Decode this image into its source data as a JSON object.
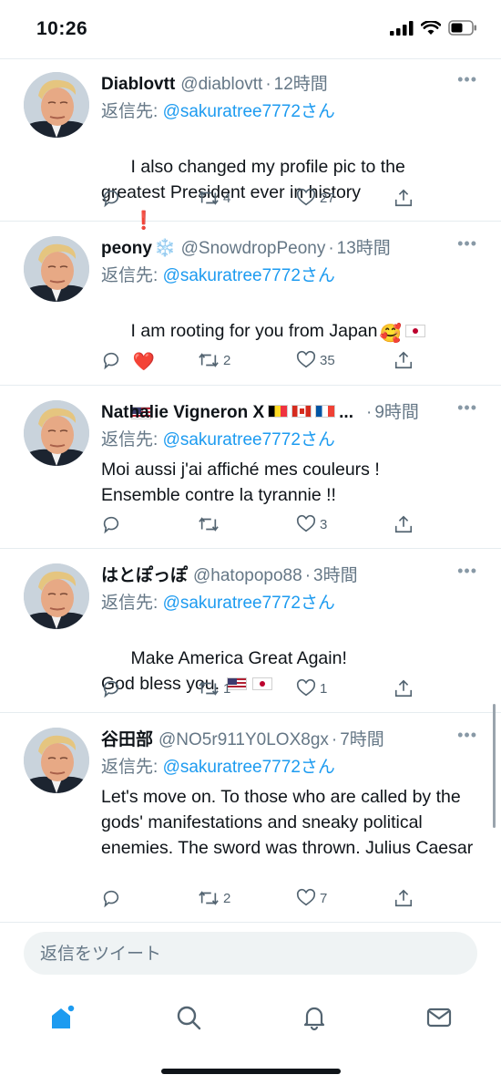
{
  "status_bar": {
    "time": "10:26"
  },
  "tweets": [
    {
      "name": "Diablovtt",
      "handle": "@diablovtt",
      "sep": "·",
      "time": "12時間",
      "reply_prefix": "返信先: ",
      "reply_mention": "@sakuratree7772",
      "reply_suffix": "さん",
      "text": "I also changed my profile pic to the greatest President ever in history",
      "text_emoji": "❗",
      "retweets": "4",
      "likes": "27"
    },
    {
      "name": "peony",
      "name_emoji": "❄️",
      "handle": "@SnowdropPeony",
      "sep": "·",
      "time": "13時間",
      "reply_prefix": "返信先: ",
      "reply_mention": "@sakuratree7772",
      "reply_suffix": "さん",
      "text": "I am rooting for you from Japan",
      "text_emoji": "🥰",
      "heart_emoji": "❤️",
      "retweets": "2",
      "likes": "35"
    },
    {
      "name": "Nathalie Vigneron X",
      "name_suffix": "...",
      "handle": "",
      "sep": "·",
      "time": "9時間",
      "reply_prefix": "返信先: ",
      "reply_mention": "@sakuratree7772",
      "reply_suffix": "さん",
      "text": "Moi aussi j'ai affiché mes couleurs !\nEnsemble contre la tyrannie !!",
      "retweets": "",
      "likes": "3"
    },
    {
      "name": "はとぽっぽ",
      "handle": "@hatopopo88",
      "sep": "·",
      "time": "3時間",
      "reply_prefix": "返信先: ",
      "reply_mention": "@sakuratree7772",
      "reply_suffix": "さん",
      "text": "Make America Great Again!\nGod bless you.",
      "retweets": "1",
      "likes": "1"
    },
    {
      "name": "谷田部",
      "handle": "@NO5r911Y0LOX8gx",
      "sep": "·",
      "time": "7時間",
      "reply_prefix": "返信先: ",
      "reply_mention": "@sakuratree7772",
      "reply_suffix": "さん",
      "text": "Let's move on. To those who are called by the gods' manifestations and sneaky political enemies. The sword was thrown. Julius Caesar",
      "retweets": "2",
      "likes": "7"
    }
  ],
  "composer": {
    "placeholder": "返信をツイート"
  },
  "icons": {
    "tweet_actions": [
      "reply-icon",
      "retweet-icon",
      "like-icon",
      "share-icon"
    ],
    "tabbar": [
      "home-icon",
      "search-icon",
      "notifications-icon",
      "messages-icon"
    ]
  },
  "colors": {
    "accent": "#1d9bf0",
    "muted": "#657786",
    "divider": "#e6ecf0"
  }
}
